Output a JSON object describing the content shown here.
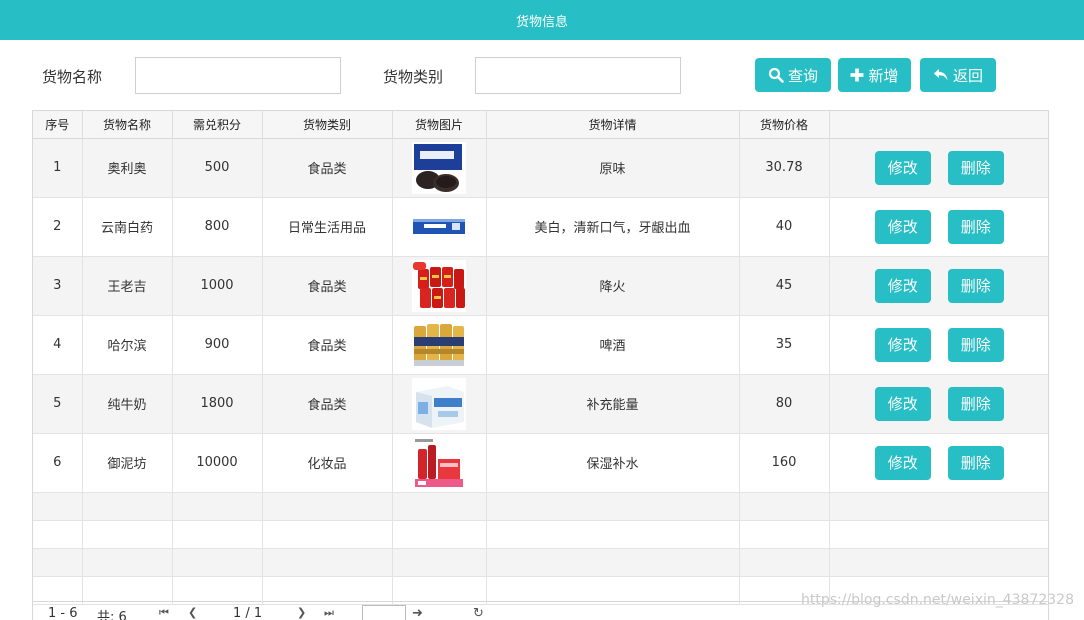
{
  "header": {
    "title": "货物信息"
  },
  "search": {
    "name_label": "货物名称",
    "name_value": "",
    "category_label": "货物类别",
    "category_value": ""
  },
  "toolbar": {
    "query_label": "查询",
    "add_label": "新增",
    "back_label": "返回"
  },
  "table": {
    "columns": [
      "序号",
      "货物名称",
      "需兑积分",
      "货物类别",
      "货物图片",
      "货物详情",
      "货物价格",
      ""
    ],
    "rows": [
      {
        "no": "1",
        "name": "奥利奥",
        "points": "500",
        "category": "食品类",
        "detail": "原味",
        "price": "30.78"
      },
      {
        "no": "2",
        "name": "云南白药",
        "points": "800",
        "category": "日常生活用品",
        "detail": "美白，清新口气，牙龈出血",
        "price": "40"
      },
      {
        "no": "3",
        "name": "王老吉",
        "points": "1000",
        "category": "食品类",
        "detail": "降火",
        "price": "45"
      },
      {
        "no": "4",
        "name": "哈尔滨",
        "points": "900",
        "category": "食品类",
        "detail": "啤酒",
        "price": "35"
      },
      {
        "no": "5",
        "name": "纯牛奶",
        "points": "1800",
        "category": "食品类",
        "detail": "补充能量",
        "price": "80"
      },
      {
        "no": "6",
        "name": "御泥坊",
        "points": "10000",
        "category": "化妆品",
        "detail": "保湿补水",
        "price": "160"
      }
    ],
    "edit_label": "修改",
    "delete_label": "删除"
  },
  "pager": {
    "range": "1 - 6",
    "total": "共: 6",
    "page": "1 / 1",
    "page_input": ""
  },
  "watermark": "https://blog.csdn.net/weixin_43872328",
  "colors": {
    "accent": "#27bfc5",
    "header_bg": "#f6f6f6",
    "row_alt": "#f4f4f4"
  }
}
